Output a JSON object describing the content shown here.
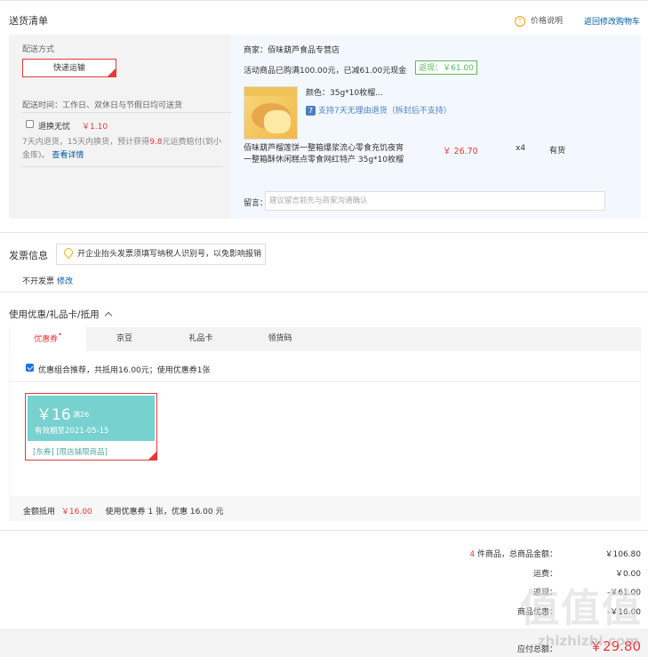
{
  "header": {
    "title": "送货清单",
    "price_info": "价格说明",
    "back_to_cart": "返回修改购物车"
  },
  "delivery": {
    "method_label": "配送方式",
    "method_value": "快递运输",
    "time_text": "配送时间：工作日、双休日与节假日均可送货",
    "option_label": "退换无忧",
    "option_price": "￥1.10",
    "option_desc_1": "7天内退货，15天内换货，预计获得",
    "option_desc_highlight": "9.8",
    "option_desc_2": "元运费赔付(到小",
    "option_desc_3": "金库)。",
    "option_detail_link": "查看详情"
  },
  "store": {
    "merchant": "商家：佰味葫芦食品专营店",
    "promo": "活动商品已购满100.00元，已减61.00元现金",
    "rebate_badge": "返现：￥61.00",
    "variant": "颜色：35g*10枚榴...",
    "return_badge": "7",
    "return_policy": "支持7天无理由退货（拆封后不支持）",
    "product_name_1": "佰味葫芦榴莲饼一整箱爆浆流心零食充饥夜宵",
    "product_name_2": "一整箱酥休闲糕点零食网红特产 35g*10枚榴",
    "price": "￥ 26.70",
    "qty": "x4",
    "stock": "有货",
    "remark_label": "留言：",
    "remark_placeholder": "建议留言前先与商家沟通确认"
  },
  "invoice": {
    "title": "发票信息",
    "tip": "开企业抬头发票须填写纳税人识别号，以免影响报销",
    "value": "不开发票",
    "edit": "修改"
  },
  "coupons": {
    "section_title": "使用优惠/礼品卡/抵用",
    "tabs": [
      "优惠券",
      "京豆",
      "礼品卡",
      "领货码"
    ],
    "recommend_text": "优惠组合推荐，共抵用16.00元；使用优惠券1张",
    "card_amount": "￥16",
    "card_condition": "满26",
    "card_validity": "有效期至2021-05-15",
    "card_tags": "[东券] [限店铺限商品]",
    "summary_label": "金额抵用",
    "summary_amount": "￥16.00",
    "summary_detail": "使用优惠券 1 张，优惠 16.00 元"
  },
  "totals": {
    "count_num": "4",
    "count_label": "件商品，总商品金额：",
    "goods_amount": "￥106.80",
    "shipping_label": "运费：",
    "shipping_amount": "￥0.00",
    "rebate_label": "返现：",
    "rebate_amount": "-￥61.00",
    "coupon_label": "商品优惠：",
    "coupon_amount": "-￥16.00",
    "payable_label": "应付总额：",
    "payable_amount": "￥29.80"
  },
  "watermark": {
    "logo": "值值值",
    "site": "zhizhizhi.com"
  },
  "colors": {
    "accent_red": "#e4393c",
    "link_blue": "#005aa0",
    "coupon_teal": "#77d1cf",
    "rebate_green": "#5cb85c"
  }
}
